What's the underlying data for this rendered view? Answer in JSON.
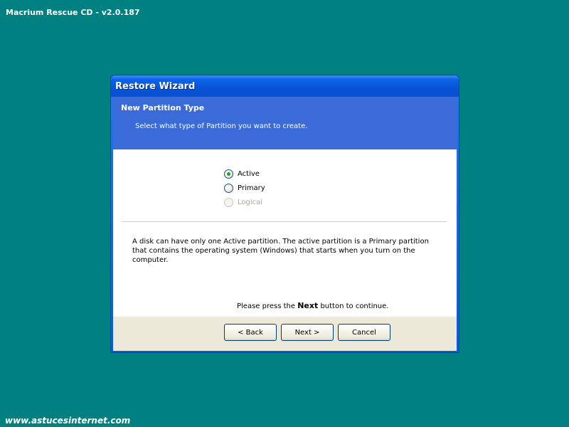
{
  "app": {
    "title": "Macrium Rescue CD - v2.0.187"
  },
  "watermark": "www.astucesinternet.com",
  "window": {
    "title": "Restore Wizard",
    "header": {
      "title": "New Partition Type",
      "subtitle": "Select what type of Partition you want to create."
    },
    "options": [
      {
        "label": "Active",
        "checked": true,
        "enabled": true
      },
      {
        "label": "Primary",
        "checked": false,
        "enabled": true
      },
      {
        "label": "Logical",
        "checked": false,
        "enabled": false
      }
    ],
    "description": "A disk can have only one Active partition. The active partition is a Primary partition that contains the operating system (Windows) that starts when you turn on the computer.",
    "continue": {
      "prefix": "Please press the",
      "bold": "Next",
      "suffix": "button to continue."
    },
    "buttons": {
      "back": "< Back",
      "next": "Next >",
      "cancel": "Cancel"
    }
  },
  "colors": {
    "desktop": "#008080",
    "header_band": "#3a6bd8",
    "selected_radio": "#21a121"
  }
}
